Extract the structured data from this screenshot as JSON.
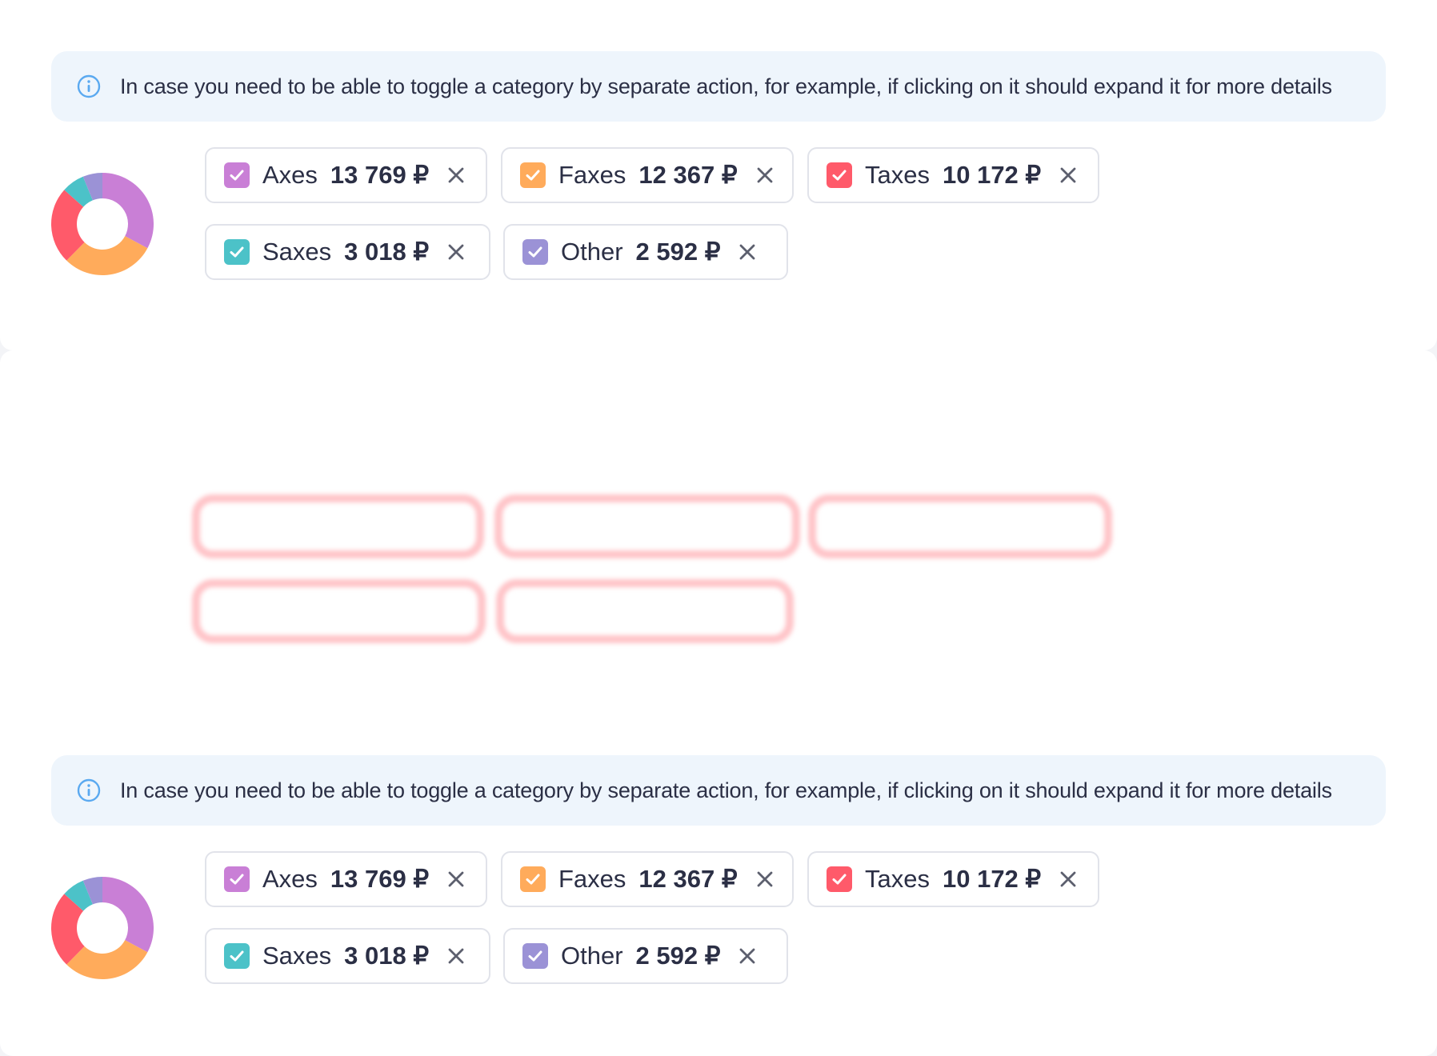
{
  "colors": {
    "axes": "#c97fd6",
    "faxes": "#ffab5b",
    "taxes": "#ff5a6a",
    "saxes": "#4cc2c8",
    "other": "#9b92d6",
    "info_bg": "#eef5fc",
    "info_icon": "#5aa9f0"
  },
  "info_text": "In case you need to be able to toggle a category by separate action, for example, if clicking on it should expand it for more details",
  "chips": [
    {
      "name": "Axes",
      "value": "13 769 ₽",
      "color_key": "axes",
      "checked": true
    },
    {
      "name": "Faxes",
      "value": "12 367 ₽",
      "color_key": "faxes",
      "checked": true
    },
    {
      "name": "Taxes",
      "value": "10 172 ₽",
      "color_key": "taxes",
      "checked": true
    },
    {
      "name": "Saxes",
      "value": "3 018 ₽",
      "color_key": "saxes",
      "checked": true
    },
    {
      "name": "Other",
      "value": "2 592 ₽",
      "color_key": "other",
      "checked": true
    }
  ],
  "donut_values": [
    13769,
    12367,
    10172,
    3018,
    2592
  ],
  "icons": {
    "info": "info-circle-icon",
    "check": "check-icon",
    "remove": "close-icon"
  }
}
